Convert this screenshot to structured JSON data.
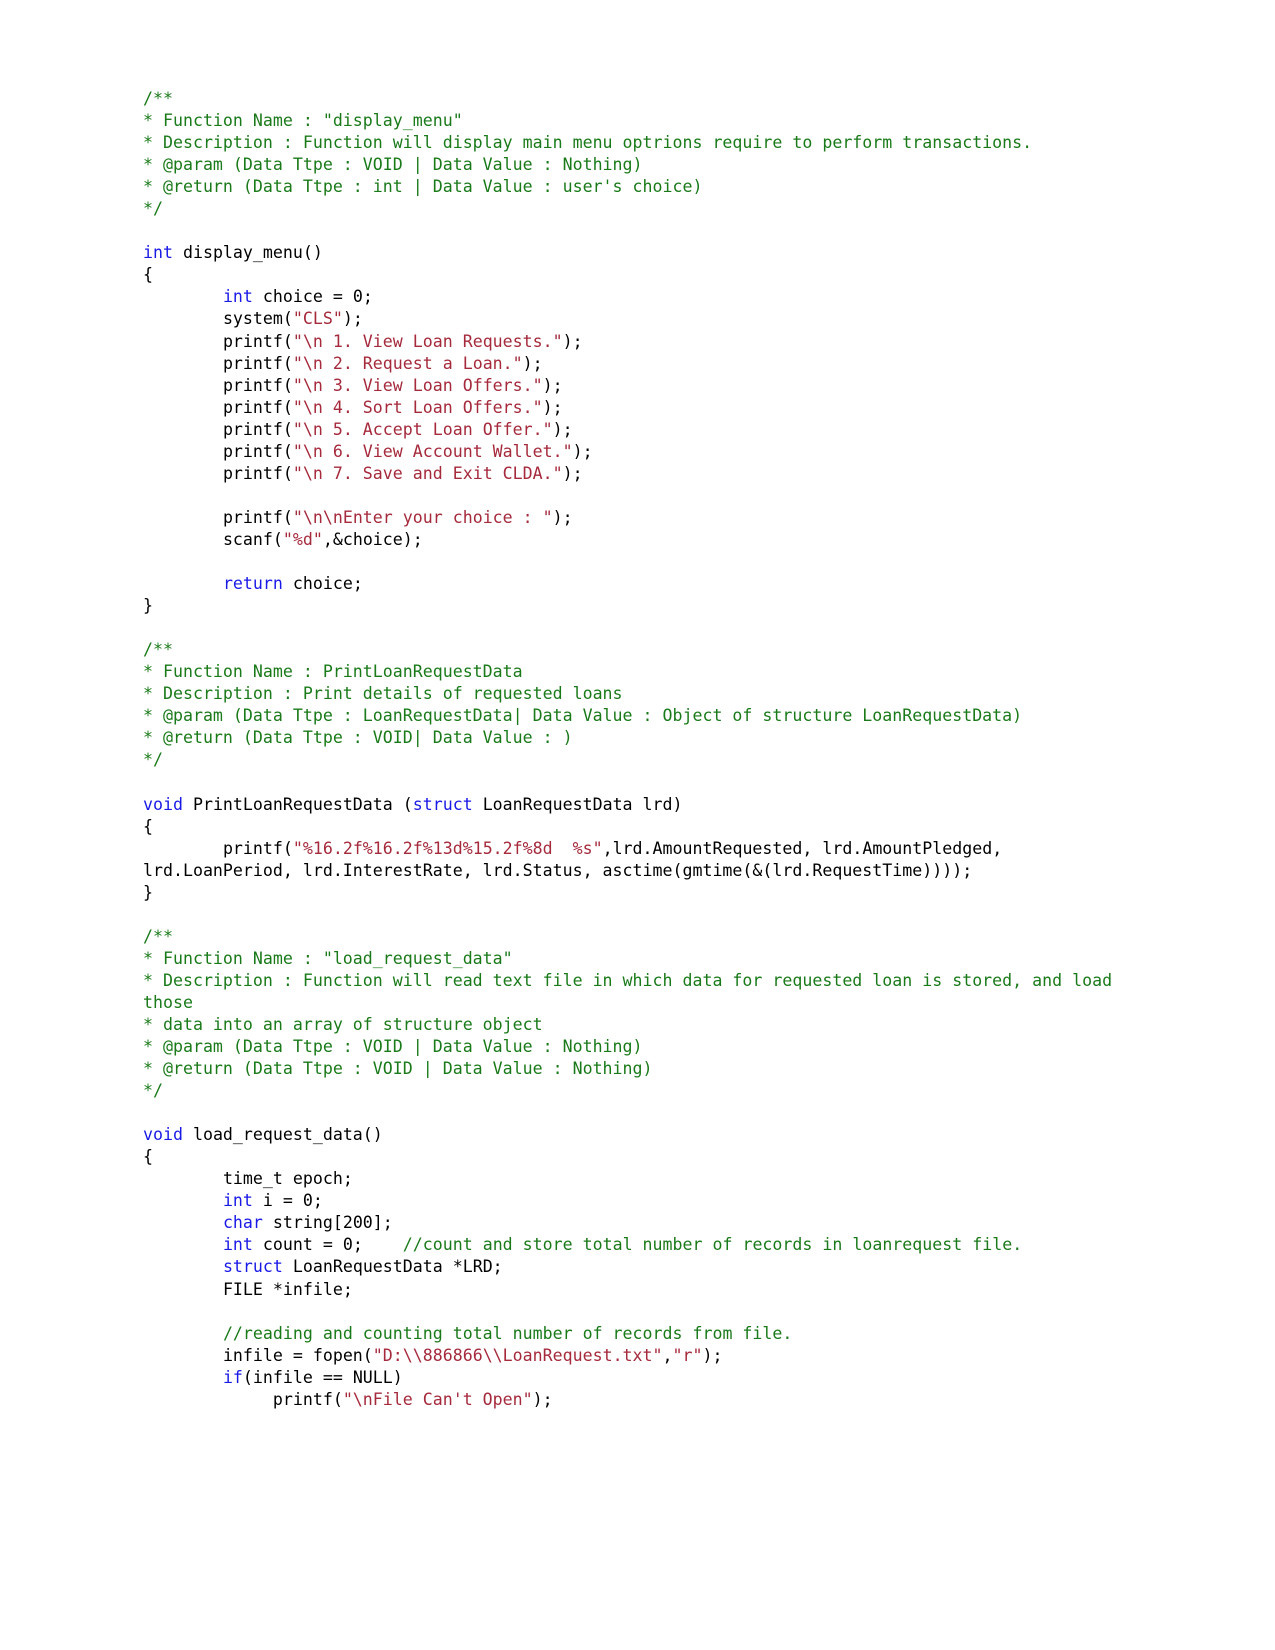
{
  "document": {
    "type": "source-code-listing",
    "language": "C",
    "colors": {
      "comment": "#1a7a1a",
      "keyword": "#1a1ae6",
      "string": "#a52a3c",
      "plain": "#000000",
      "background": "#ffffff"
    }
  },
  "lines": [
    {
      "id": "l1",
      "segments": [
        {
          "t": "comment",
          "s": "/**"
        }
      ]
    },
    {
      "id": "l2",
      "segments": [
        {
          "t": "comment",
          "s": "* Function Name : \"display_menu\""
        }
      ]
    },
    {
      "id": "l3",
      "segments": [
        {
          "t": "comment",
          "s": "* Description : Function will display main menu optrions require to perform transactions."
        }
      ]
    },
    {
      "id": "l4",
      "segments": [
        {
          "t": "comment",
          "s": "* @param (Data Ttpe : VOID | Data Value : Nothing)"
        }
      ]
    },
    {
      "id": "l5",
      "segments": [
        {
          "t": "comment",
          "s": "* @return (Data Ttpe : int | Data Value : user's choice)"
        }
      ]
    },
    {
      "id": "l6",
      "segments": [
        {
          "t": "comment",
          "s": "*/"
        }
      ]
    },
    {
      "id": "l7",
      "segments": []
    },
    {
      "id": "l8",
      "segments": [
        {
          "t": "keyword",
          "s": "int"
        },
        {
          "t": "plain",
          "s": " display_menu()"
        }
      ]
    },
    {
      "id": "l9",
      "segments": [
        {
          "t": "plain",
          "s": "{"
        }
      ]
    },
    {
      "id": "l10",
      "segments": [
        {
          "t": "plain",
          "s": "        "
        },
        {
          "t": "keyword",
          "s": "int"
        },
        {
          "t": "plain",
          "s": " choice = 0;"
        }
      ]
    },
    {
      "id": "l11",
      "segments": [
        {
          "t": "plain",
          "s": "        system("
        },
        {
          "t": "string",
          "s": "\"CLS\""
        },
        {
          "t": "plain",
          "s": ");"
        }
      ]
    },
    {
      "id": "l12",
      "segments": [
        {
          "t": "plain",
          "s": "        printf("
        },
        {
          "t": "string",
          "s": "\"\\n 1. View Loan Requests.\""
        },
        {
          "t": "plain",
          "s": ");"
        }
      ]
    },
    {
      "id": "l13",
      "segments": [
        {
          "t": "plain",
          "s": "        printf("
        },
        {
          "t": "string",
          "s": "\"\\n 2. Request a Loan.\""
        },
        {
          "t": "plain",
          "s": ");"
        }
      ]
    },
    {
      "id": "l14",
      "segments": [
        {
          "t": "plain",
          "s": "        printf("
        },
        {
          "t": "string",
          "s": "\"\\n 3. View Loan Offers.\""
        },
        {
          "t": "plain",
          "s": ");"
        }
      ]
    },
    {
      "id": "l15",
      "segments": [
        {
          "t": "plain",
          "s": "        printf("
        },
        {
          "t": "string",
          "s": "\"\\n 4. Sort Loan Offers.\""
        },
        {
          "t": "plain",
          "s": ");"
        }
      ]
    },
    {
      "id": "l16",
      "segments": [
        {
          "t": "plain",
          "s": "        printf("
        },
        {
          "t": "string",
          "s": "\"\\n 5. Accept Loan Offer.\""
        },
        {
          "t": "plain",
          "s": ");"
        }
      ]
    },
    {
      "id": "l17",
      "segments": [
        {
          "t": "plain",
          "s": "        printf("
        },
        {
          "t": "string",
          "s": "\"\\n 6. View Account Wallet.\""
        },
        {
          "t": "plain",
          "s": ");"
        }
      ]
    },
    {
      "id": "l18",
      "segments": [
        {
          "t": "plain",
          "s": "        printf("
        },
        {
          "t": "string",
          "s": "\"\\n 7. Save and Exit CLDA.\""
        },
        {
          "t": "plain",
          "s": ");"
        }
      ]
    },
    {
      "id": "l19",
      "segments": []
    },
    {
      "id": "l20",
      "segments": [
        {
          "t": "plain",
          "s": "        printf("
        },
        {
          "t": "string",
          "s": "\"\\n\\nEnter your choice : \""
        },
        {
          "t": "plain",
          "s": ");"
        }
      ]
    },
    {
      "id": "l21",
      "segments": [
        {
          "t": "plain",
          "s": "        scanf("
        },
        {
          "t": "string",
          "s": "\"%d\""
        },
        {
          "t": "plain",
          "s": ",&choice);"
        }
      ]
    },
    {
      "id": "l22",
      "segments": []
    },
    {
      "id": "l23",
      "segments": [
        {
          "t": "plain",
          "s": "        "
        },
        {
          "t": "keyword",
          "s": "return"
        },
        {
          "t": "plain",
          "s": " choice;"
        }
      ]
    },
    {
      "id": "l24",
      "segments": [
        {
          "t": "plain",
          "s": "}"
        }
      ]
    },
    {
      "id": "l25",
      "segments": []
    },
    {
      "id": "l26",
      "segments": [
        {
          "t": "comment",
          "s": "/**"
        }
      ]
    },
    {
      "id": "l27",
      "segments": [
        {
          "t": "comment",
          "s": "* Function Name : PrintLoanRequestData"
        }
      ]
    },
    {
      "id": "l28",
      "segments": [
        {
          "t": "comment",
          "s": "* Description : Print details of requested loans"
        }
      ]
    },
    {
      "id": "l29",
      "segments": [
        {
          "t": "comment",
          "s": "* @param (Data Ttpe : LoanRequestData| Data Value : Object of structure LoanRequestData)"
        }
      ]
    },
    {
      "id": "l30",
      "segments": [
        {
          "t": "comment",
          "s": "* @return (Data Ttpe : VOID| Data Value : )"
        }
      ]
    },
    {
      "id": "l31",
      "segments": [
        {
          "t": "comment",
          "s": "*/"
        }
      ]
    },
    {
      "id": "l32",
      "segments": []
    },
    {
      "id": "l33",
      "segments": [
        {
          "t": "keyword",
          "s": "void"
        },
        {
          "t": "plain",
          "s": " PrintLoanRequestData ("
        },
        {
          "t": "keyword",
          "s": "struct"
        },
        {
          "t": "plain",
          "s": " LoanRequestData lrd)"
        }
      ]
    },
    {
      "id": "l34",
      "segments": [
        {
          "t": "plain",
          "s": "{"
        }
      ]
    },
    {
      "id": "l35",
      "segments": [
        {
          "t": "plain",
          "s": "        printf("
        },
        {
          "t": "string",
          "s": "\"%16.2f%16.2f%13d%15.2f%8d  %s\""
        },
        {
          "t": "plain",
          "s": ",lrd.AmountRequested, lrd.AmountPledged, lrd.LoanPeriod, lrd.InterestRate, lrd.Status, asctime(gmtime(&(lrd.RequestTime))));"
        }
      ]
    },
    {
      "id": "l36",
      "segments": [
        {
          "t": "plain",
          "s": "}"
        }
      ]
    },
    {
      "id": "l37",
      "segments": []
    },
    {
      "id": "l38",
      "segments": [
        {
          "t": "comment",
          "s": "/**"
        }
      ]
    },
    {
      "id": "l39",
      "segments": [
        {
          "t": "comment",
          "s": "* Function Name : \"load_request_data\""
        }
      ]
    },
    {
      "id": "l40",
      "segments": [
        {
          "t": "comment",
          "s": "* Description : Function will read text file in which data for requested loan is stored, and load those"
        }
      ]
    },
    {
      "id": "l41",
      "segments": [
        {
          "t": "comment",
          "s": "* data into an array of structure object"
        }
      ]
    },
    {
      "id": "l42",
      "segments": [
        {
          "t": "comment",
          "s": "* @param (Data Ttpe : VOID | Data Value : Nothing)"
        }
      ]
    },
    {
      "id": "l43",
      "segments": [
        {
          "t": "comment",
          "s": "* @return (Data Ttpe : VOID | Data Value : Nothing)"
        }
      ]
    },
    {
      "id": "l44",
      "segments": [
        {
          "t": "comment",
          "s": "*/"
        }
      ]
    },
    {
      "id": "l45",
      "segments": []
    },
    {
      "id": "l46",
      "segments": [
        {
          "t": "keyword",
          "s": "void"
        },
        {
          "t": "plain",
          "s": " load_request_data()"
        }
      ]
    },
    {
      "id": "l47",
      "segments": [
        {
          "t": "plain",
          "s": "{"
        }
      ]
    },
    {
      "id": "l48",
      "segments": [
        {
          "t": "plain",
          "s": "        time_t epoch;"
        }
      ]
    },
    {
      "id": "l49",
      "segments": [
        {
          "t": "plain",
          "s": "        "
        },
        {
          "t": "keyword",
          "s": "int"
        },
        {
          "t": "plain",
          "s": " i = 0;"
        }
      ]
    },
    {
      "id": "l50",
      "segments": [
        {
          "t": "plain",
          "s": "        "
        },
        {
          "t": "keyword",
          "s": "char"
        },
        {
          "t": "plain",
          "s": " string[200];"
        }
      ]
    },
    {
      "id": "l51",
      "segments": [
        {
          "t": "plain",
          "s": "        "
        },
        {
          "t": "keyword",
          "s": "int"
        },
        {
          "t": "plain",
          "s": " count = 0;    "
        },
        {
          "t": "comment",
          "s": "//count and store total number of records in loanrequest file."
        }
      ]
    },
    {
      "id": "l52",
      "segments": [
        {
          "t": "plain",
          "s": "        "
        },
        {
          "t": "keyword",
          "s": "struct"
        },
        {
          "t": "plain",
          "s": " LoanRequestData *LRD;"
        }
      ]
    },
    {
      "id": "l53",
      "segments": [
        {
          "t": "plain",
          "s": "        FILE *infile;"
        }
      ]
    },
    {
      "id": "l54",
      "segments": []
    },
    {
      "id": "l55",
      "segments": [
        {
          "t": "plain",
          "s": "        "
        },
        {
          "t": "comment",
          "s": "//reading and counting total number of records from file."
        }
      ]
    },
    {
      "id": "l56",
      "segments": [
        {
          "t": "plain",
          "s": "        infile = fopen("
        },
        {
          "t": "string",
          "s": "\"D:\\\\886866\\\\LoanRequest.txt\""
        },
        {
          "t": "plain",
          "s": ","
        },
        {
          "t": "string",
          "s": "\"r\""
        },
        {
          "t": "plain",
          "s": ");"
        }
      ]
    },
    {
      "id": "l57",
      "segments": [
        {
          "t": "plain",
          "s": "        "
        },
        {
          "t": "keyword",
          "s": "if"
        },
        {
          "t": "plain",
          "s": "(infile == NULL)"
        }
      ]
    },
    {
      "id": "l58",
      "segments": [
        {
          "t": "plain",
          "s": "             printf("
        },
        {
          "t": "string",
          "s": "\"\\nFile Can't Open\""
        },
        {
          "t": "plain",
          "s": ");"
        }
      ]
    }
  ]
}
